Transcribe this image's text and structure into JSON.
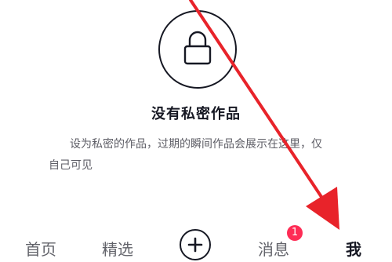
{
  "empty_state": {
    "icon": "lock-icon",
    "title": "没有私密作品",
    "description_line1": "设为私密的作品，过期的瞬间作品会展示在这里，仅",
    "description_line2": "自己可见"
  },
  "tabbar": {
    "tabs": [
      {
        "label": "首页",
        "active": false
      },
      {
        "label": "精选",
        "active": false
      },
      {
        "label": "消息",
        "active": false
      },
      {
        "label": "我",
        "active": true
      }
    ],
    "plus_icon": "plus-icon",
    "message_badge": "1"
  },
  "colors": {
    "text": "#161823",
    "secondary": "#5e5e66",
    "badge": "#fe2c55",
    "annotation_arrow": "#e8232a"
  }
}
